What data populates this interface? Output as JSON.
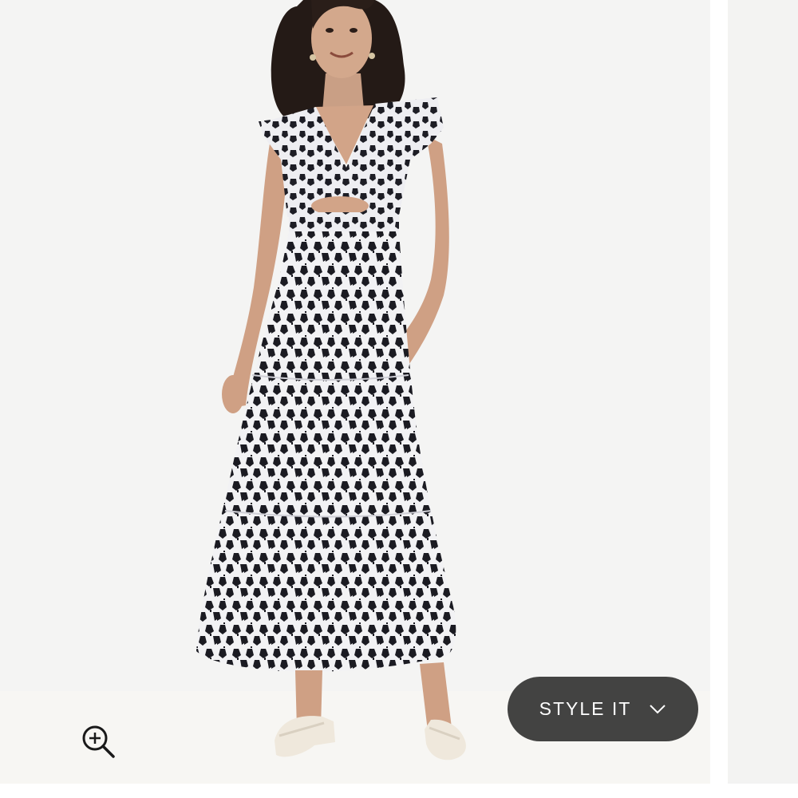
{
  "product_viewer": {
    "main_image": {
      "semantic": "model-wearing-printed-maxi-dress",
      "alt": ""
    },
    "zoom_control": {
      "icon": "zoom-in-icon"
    },
    "style_it": {
      "label": "STYLE IT",
      "icon": "chevron-down-icon",
      "background": "#434342",
      "text_color": "#ffffff"
    }
  }
}
